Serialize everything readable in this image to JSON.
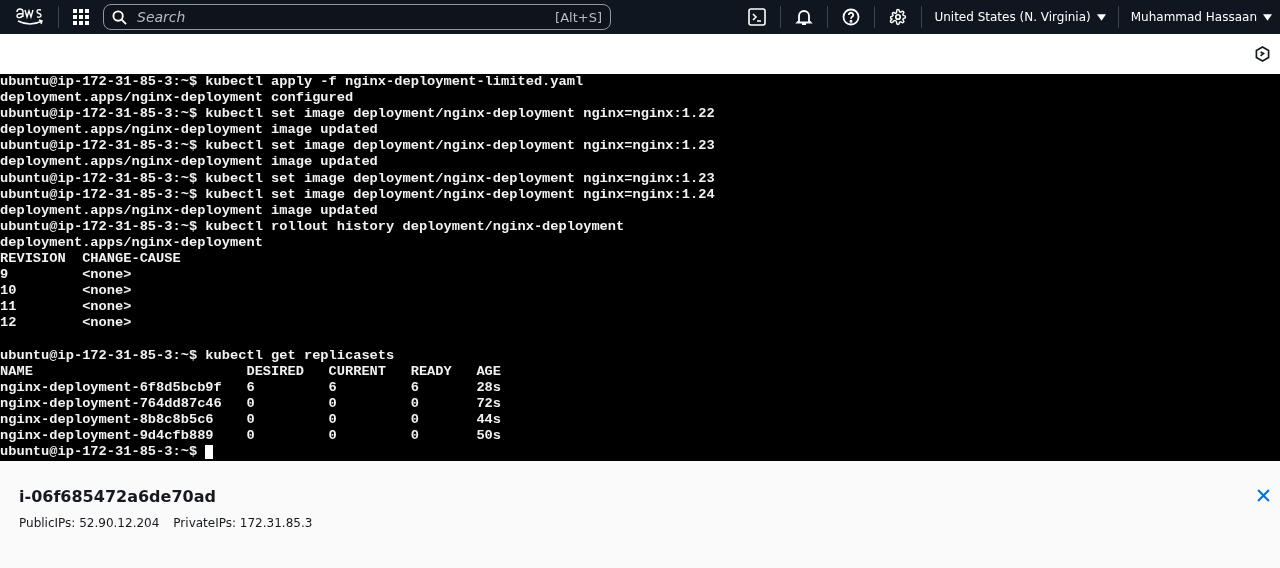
{
  "top_nav": {
    "search": {
      "placeholder": "Search",
      "shortcut": "[Alt+S]"
    },
    "region": "United States (N. Virginia)",
    "user": "Muhammad Hassaan"
  },
  "terminal": {
    "lines": [
      {
        "kind": "text",
        "text": "ubuntu@ip-172-31-85-3:~$ kubectl apply -f nginx-deployment-limited.yaml"
      },
      {
        "kind": "text",
        "text": "deployment.apps/nginx-deployment configured"
      },
      {
        "kind": "text",
        "text": "ubuntu@ip-172-31-85-3:~$ kubectl set image deployment/nginx-deployment nginx=nginx:1.22"
      },
      {
        "kind": "text",
        "text": "deployment.apps/nginx-deployment image updated"
      },
      {
        "kind": "text",
        "text": "ubuntu@ip-172-31-85-3:~$ kubectl set image deployment/nginx-deployment nginx=nginx:1.23"
      },
      {
        "kind": "text",
        "text": "deployment.apps/nginx-deployment image updated"
      },
      {
        "kind": "text",
        "text": "ubuntu@ip-172-31-85-3:~$ kubectl set image deployment/nginx-deployment nginx=nginx:1.23"
      },
      {
        "kind": "text",
        "text": "ubuntu@ip-172-31-85-3:~$ kubectl set image deployment/nginx-deployment nginx=nginx:1.24"
      },
      {
        "kind": "text",
        "text": "deployment.apps/nginx-deployment image updated"
      },
      {
        "kind": "text",
        "text": "ubuntu@ip-172-31-85-3:~$ kubectl rollout history deployment/nginx-deployment"
      },
      {
        "kind": "text",
        "text": "deployment.apps/nginx-deployment"
      },
      {
        "kind": "text",
        "text": "REVISION  CHANGE-CAUSE"
      },
      {
        "kind": "text",
        "text": "9         <none>"
      },
      {
        "kind": "text",
        "text": "10        <none>"
      },
      {
        "kind": "text",
        "text": "11        <none>"
      },
      {
        "kind": "text",
        "text": "12        <none>"
      },
      {
        "kind": "blank"
      },
      {
        "kind": "text",
        "text": "ubuntu@ip-172-31-85-3:~$ kubectl get replicasets"
      },
      {
        "kind": "text",
        "text": "NAME                          DESIRED   CURRENT   READY   AGE"
      },
      {
        "kind": "text",
        "text": "nginx-deployment-6f8d5bcb9f   6         6         6       28s"
      },
      {
        "kind": "text",
        "text": "nginx-deployment-764dd87c46   0         0         0       72s"
      },
      {
        "kind": "text",
        "text": "nginx-deployment-8b8c8b5c6    0         0         0       44s"
      },
      {
        "kind": "text",
        "text": "nginx-deployment-9d4cfb889    0         0         0       50s"
      },
      {
        "kind": "prompt",
        "text": "ubuntu@ip-172-31-85-3:~$"
      }
    ]
  },
  "instance_panel": {
    "instance_id": "i-06f685472a6de70ad",
    "public_ips": "PublicIPs: 52.90.12.204",
    "private_ips": "PrivateIPs: 172.31.85.3"
  }
}
